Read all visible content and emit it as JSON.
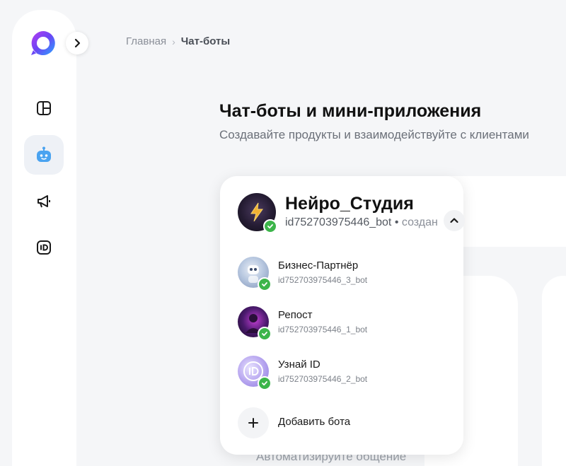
{
  "breadcrumb": {
    "home": "Главная",
    "separator": "›",
    "current": "Чат-боты"
  },
  "header": {
    "title": "Чат-боты и мини-приложения",
    "subtitle": "Создавайте продукты и взаимодействуйте с клиентами"
  },
  "sidebar": {
    "logo_icon": "app-logo",
    "expand_icon": "chevron-right-icon",
    "items": [
      {
        "name": "dashboard",
        "icon": "dashboard-icon",
        "active": false
      },
      {
        "name": "chatbots",
        "icon": "robot-icon",
        "active": true
      },
      {
        "name": "promotion",
        "icon": "megaphone-icon",
        "active": false
      },
      {
        "name": "id",
        "icon": "id-icon",
        "active": false
      }
    ]
  },
  "bot_switcher": {
    "current": {
      "name": "Нейро_Студия",
      "id": "id752703975446_bot",
      "separator": "•",
      "status": "создан"
    },
    "bots": [
      {
        "name": "Бизнес-Партнёр",
        "id": "id752703975446_3_bot"
      },
      {
        "name": "Репост",
        "id": "id752703975446_1_bot"
      },
      {
        "name": "Узнай ID",
        "id": "id752703975446_2_bot"
      }
    ],
    "add_label": "Добавить бота"
  },
  "background": {
    "card_text": "Автоматизируйте общение"
  },
  "colors": {
    "accent": "#3cb54a",
    "brand_gradient_start": "#7b3cf0",
    "brand_gradient_end": "#2aa5ff",
    "nav_icon": "#1a1a1a",
    "robot_icon": "#4aa3f0"
  }
}
